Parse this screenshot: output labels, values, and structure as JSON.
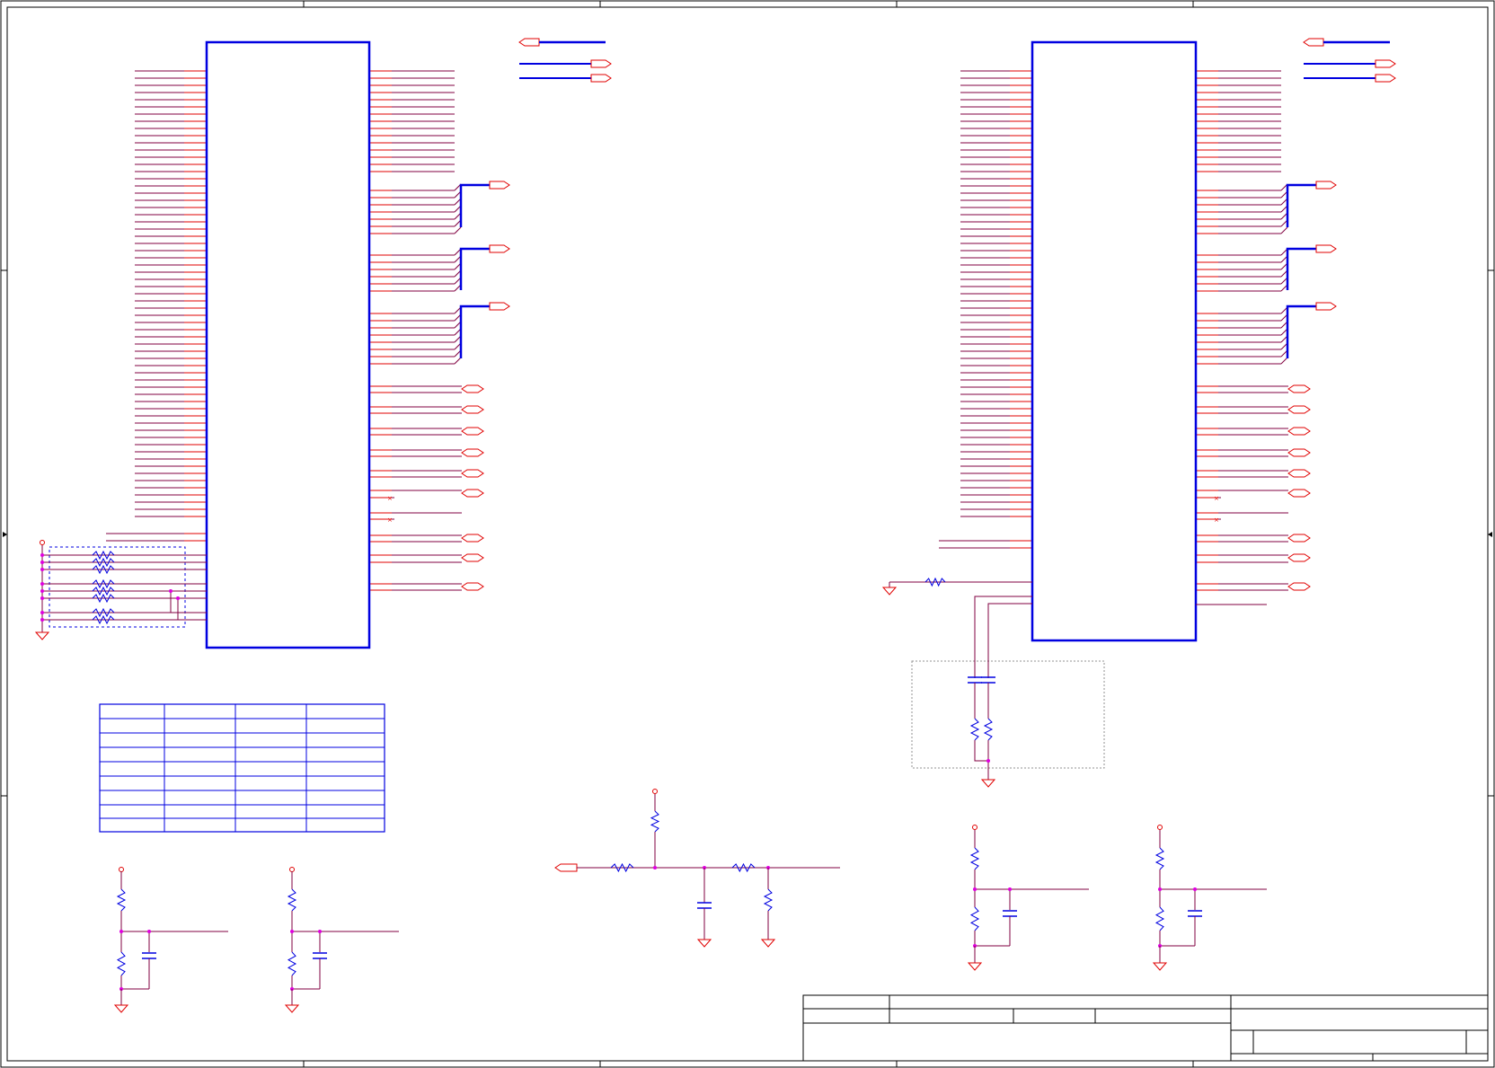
{
  "sheet": {
    "type": "electrical-schematic",
    "text_visible": false,
    "title_block_text": []
  },
  "colors": {
    "background": "#ffffff",
    "border": "#000000",
    "wire": "#800040",
    "pin": "#e00000",
    "component_body": "#0000e0",
    "bus": "#0000e0",
    "junction": "#e000e0",
    "power_port": "#e00000",
    "dashed_box_blue": "#0000e0",
    "dashed_box_gray": "#909090"
  },
  "components": {
    "ic_left": {
      "name": "ic-left",
      "type": "ic-symbol"
    },
    "ic_right": {
      "name": "ic-right",
      "type": "ic-symbol"
    },
    "resistor_network": {
      "name": "resistor-network-left",
      "type": "resistor-array"
    },
    "filter_network": {
      "name": "rc-filter-right",
      "type": "rc-network"
    },
    "pin_table": {
      "name": "pin-assignment-table",
      "type": "table",
      "rows": 8,
      "columns": 4
    },
    "divider_a": {
      "name": "voltage-divider-a",
      "type": "rc-divider"
    },
    "divider_b": {
      "name": "voltage-divider-b",
      "type": "rc-divider"
    },
    "pi_filter": {
      "name": "center-filter",
      "type": "rc-filter"
    },
    "divider_c": {
      "name": "voltage-divider-c",
      "type": "rc-divider"
    },
    "divider_d": {
      "name": "voltage-divider-d",
      "type": "rc-divider"
    },
    "title_block": {
      "name": "title-block",
      "type": "title-block"
    }
  }
}
